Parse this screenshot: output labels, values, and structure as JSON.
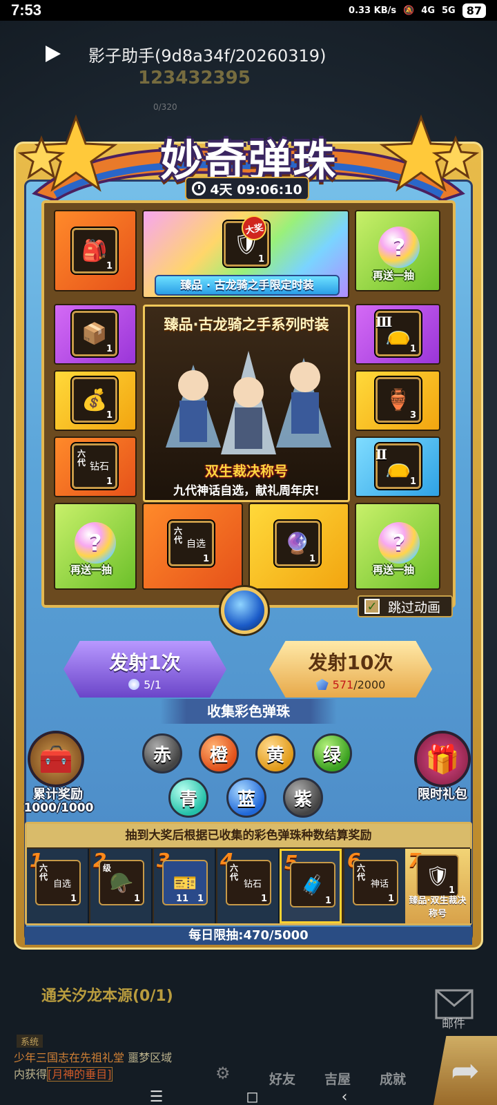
{
  "status_bar": {
    "time": "7:53",
    "net_speed": "0.33 KB/s",
    "sig1": "4G",
    "sig2": "5G",
    "battery": "87"
  },
  "assistant_bar": {
    "title": "影子助手(9d8a34f/20260319)"
  },
  "background_hud": {
    "id_number": "123432395",
    "progress": "0/320"
  },
  "event": {
    "title": "妙奇弹珠",
    "countdown": "4天 09:06:10",
    "grand_prize_banner": "臻品 · 古龙骑之手限定时装",
    "grand_prize_badge": "大奖",
    "center_title": "臻品·古龙骑之手系列时装",
    "center_sub1": "双生裁决称号",
    "center_sub2": "九代神话自选，献礼周年庆!",
    "bonus_label": "再送一抽",
    "skip_label": "跳过动画"
  },
  "grid_items": {
    "tl": {
      "count": "1"
    },
    "top": {
      "count": "1"
    },
    "l1": {
      "count": "1"
    },
    "l2": {
      "count": "1"
    },
    "l3": {
      "count": "1",
      "tag": "六代",
      "tag2": "钻石"
    },
    "r1": {
      "count": "1",
      "roman": "Ⅲ"
    },
    "r2": {
      "count": "3"
    },
    "r3": {
      "count": "1",
      "roman": "Ⅱ"
    },
    "b2": {
      "count": "1",
      "tag": "六代",
      "tag2": "自选"
    },
    "b3": {
      "count": "1"
    }
  },
  "actions": {
    "fire1": {
      "label": "发射1次",
      "cost": "5/1"
    },
    "fire10": {
      "label": "发射10次",
      "cost_owned": "571",
      "cost_need": "/2000"
    }
  },
  "collect": {
    "title": "收集彩色弹珠",
    "orbs": [
      "赤",
      "橙",
      "黄",
      "绿",
      "青",
      "蓝",
      "紫"
    ]
  },
  "side": {
    "cumulative_label": "累计奖励",
    "cumulative_progress": "1000/1000",
    "gift_label": "限时礼包"
  },
  "rewards": {
    "header": "抽到大奖后根据已收集的彩色弹珠种数结算奖励",
    "slots": [
      {
        "num": "1",
        "tag": "六代",
        "tag2": "自选",
        "count": "1"
      },
      {
        "num": "2",
        "tag": "级",
        "count": "1"
      },
      {
        "num": "3",
        "count": "1",
        "extra": "11"
      },
      {
        "num": "4",
        "tag": "六代",
        "tag2": "钻石",
        "count": "1"
      },
      {
        "num": "5",
        "count": "1"
      },
      {
        "num": "6",
        "tag": "六代",
        "tag2": "神话",
        "count": "1"
      },
      {
        "num": "7",
        "count": "1",
        "label": "臻品·双生裁决称号"
      }
    ],
    "daily_limit": "每日限抽:470/5000"
  },
  "bottom": {
    "quest": "通关汐龙本源(0/1)",
    "mail_label": "邮件",
    "sys_tag": "系统",
    "news_1": "少年三国志在先祖礼堂",
    "news_2": "噩梦区域",
    "news_3": "内获得",
    "news_4": "[月神的垂目]",
    "nav_friends": "好友",
    "nav_house": "吉屋",
    "nav_achieve": "成就"
  },
  "colors": {
    "orange": "#e6521a",
    "purple": "#9a36d8",
    "yellow": "#f2a510",
    "green": "#6cc02a",
    "blue": "#2fa2e4"
  }
}
